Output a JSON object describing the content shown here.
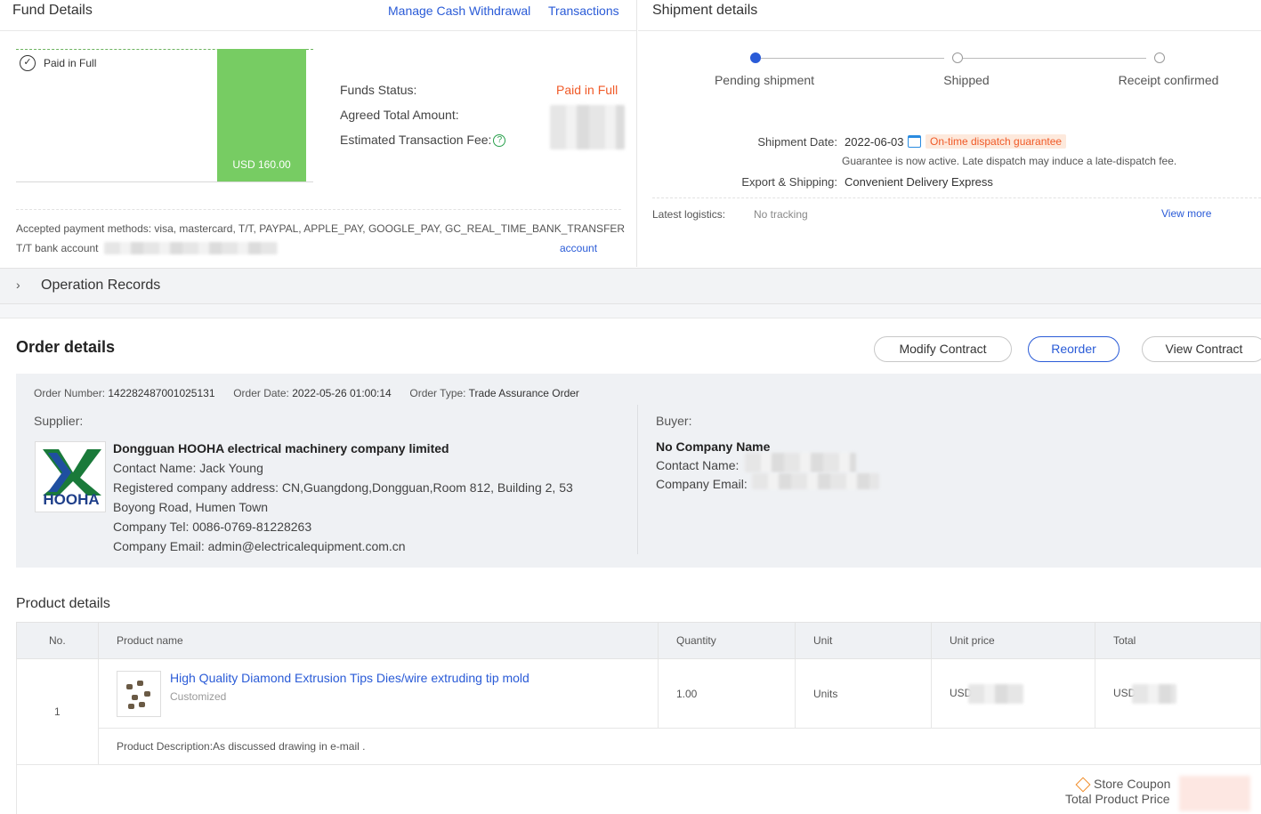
{
  "fund": {
    "title": "Fund Details",
    "manage_link": "Manage Cash Withdrawal",
    "transactions_link": "Transactions",
    "paid_label": "Paid in Full",
    "bar_label": "USD 160.00",
    "funds_status_label": "Funds Status:",
    "funds_status_value": "Paid in Full",
    "agreed_total_label": "Agreed Total Amount:",
    "fee_label": "Estimated Transaction Fee:",
    "accepted_methods": "Accepted payment methods: visa, mastercard, T/T, PAYPAL, APPLE_PAY, GOOGLE_PAY, GC_REAL_TIME_BANK_TRANSFER",
    "tt_label": "T/T bank account",
    "account_link": "account"
  },
  "shipment": {
    "title": "Shipment details",
    "steps": [
      "Pending shipment",
      "Shipped",
      "Receipt confirmed"
    ],
    "date_label": "Shipment Date:",
    "date_value": "2022-06-03",
    "dispatch_badge": "On-time dispatch guarantee",
    "guarantee_note": "Guarantee is now active. Late dispatch may induce a late-dispatch fee.",
    "export_label": "Export & Shipping:",
    "export_value": "Convenient Delivery Express",
    "logistics_label": "Latest logistics:",
    "logistics_value": "No tracking",
    "view_more": "View more"
  },
  "operation_records": {
    "title": "Operation Records"
  },
  "order": {
    "title": "Order details",
    "buttons": {
      "modify": "Modify Contract",
      "reorder": "Reorder",
      "view": "View Contract"
    },
    "number_label": "Order Number:",
    "number_value": "142282487001025131",
    "date_label": "Order Date:",
    "date_value": "2022-05-26 01:00:14",
    "type_label": "Order Type:",
    "type_value": "Trade Assurance Order",
    "supplier_label": "Supplier:",
    "supplier": {
      "logo_text": "HOOHA",
      "name": "Dongguan HOOHA electrical machinery company limited",
      "contact": "Contact Name: Jack Young",
      "address": "Registered company address: CN,Guangdong,Dongguan,Room 812, Building 2, 53 Boyong Road, Humen Town",
      "tel": "Company Tel: 0086-0769-81228263",
      "email": "Company Email: admin@electricalequipment.com.cn"
    },
    "buyer_label": "Buyer:",
    "buyer": {
      "name": "No Company Name",
      "contact_label": "Contact Name:",
      "email_label": "Company Email:"
    }
  },
  "products": {
    "title": "Product details",
    "headers": [
      "No.",
      "Product name",
      "Quantity",
      "Unit",
      "Unit price",
      "Total"
    ],
    "rows": [
      {
        "no": "1",
        "name": "High Quality Diamond Extrusion Tips Dies/wire extruding tip mold",
        "sub": "Customized",
        "quantity": "1.00",
        "unit": "Units",
        "unit_price_prefix": "USD",
        "total_prefix": "USD",
        "description": "Product Description:As discussed drawing in e-mail ."
      }
    ],
    "coupon_label": "Store Coupon",
    "total_label": "Total Product Price"
  },
  "colors": {
    "accent": "#2a5bd7",
    "paid_bar": "#77cc63",
    "status": "#f05a28"
  }
}
